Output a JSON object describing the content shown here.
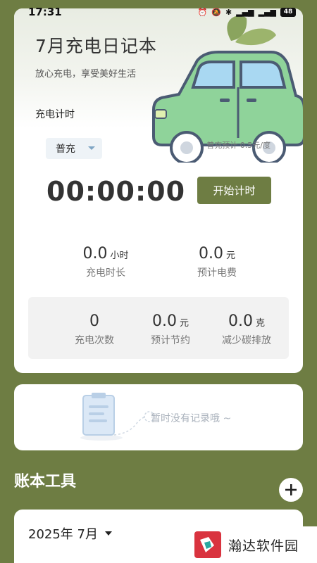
{
  "status_bar": {
    "time": "17:31",
    "battery": "48"
  },
  "header": {
    "title": "7月充电日记本",
    "subtitle": "放心充电，享受美好生活"
  },
  "timer_section": {
    "label": "充电计时",
    "mode_selected": "普充",
    "rate_text": "普充预计 0.5元/度",
    "timer": "00:00:00",
    "start_button": "开始计时"
  },
  "stats": {
    "duration": {
      "value": "0.0",
      "unit": "小时",
      "label": "充电时长"
    },
    "cost": {
      "value": "0.0",
      "unit": "元",
      "label": "预计电费"
    }
  },
  "summary": {
    "count": {
      "value": "0",
      "unit": "",
      "label": "充电次数"
    },
    "savings": {
      "value": "0.0",
      "unit": "元",
      "label": "预计节约"
    },
    "carbon": {
      "value": "0.0",
      "unit": "克",
      "label": "减少碳排放"
    }
  },
  "records": {
    "empty_text": "暂时没有记录哦 ~"
  },
  "tools": {
    "title": "账本工具",
    "month_selected": "2025年 7月"
  },
  "watermark": {
    "text": "瀚达软件园"
  },
  "colors": {
    "accent": "#6e7d43",
    "car_body": "#8fd39a",
    "window": "#a9d8f2",
    "leaf": "#8aa45e"
  },
  "icons": [
    "alarm-icon",
    "mute-icon",
    "bluetooth-icon",
    "signal-icon",
    "battery-icon",
    "car-icon",
    "leaf-icon",
    "caret-down-icon",
    "clipboard-icon",
    "plus-icon",
    "logo-icon"
  ]
}
